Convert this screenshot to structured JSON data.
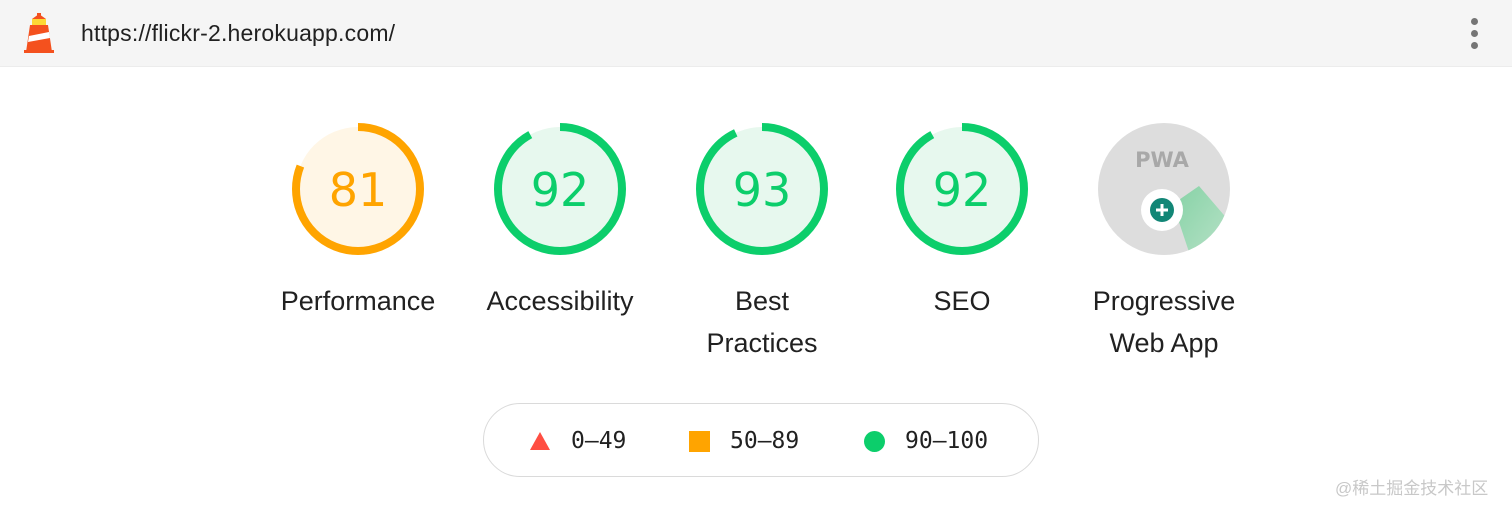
{
  "browser": {
    "url": "https://flickr-2.herokuapp.com/",
    "logo_icon": "lighthouse-icon",
    "menu_icon": "more-vert-icon"
  },
  "colors": {
    "fail": "#ff4e42",
    "average": "#ffa400",
    "pass": "#0cce6b",
    "pwa_badge": "#dddddd"
  },
  "categories": [
    {
      "name": "Performance",
      "label_lines": [
        "Performance"
      ],
      "score": "81",
      "status": "average"
    },
    {
      "name": "Accessibility",
      "label_lines": [
        "Accessibility"
      ],
      "score": "92",
      "status": "pass"
    },
    {
      "name": "Best Practices",
      "label_lines": [
        "Best",
        "Practices"
      ],
      "score": "93",
      "status": "pass"
    },
    {
      "name": "SEO",
      "label_lines": [
        "SEO"
      ],
      "score": "92",
      "status": "pass"
    },
    {
      "name": "Progressive Web App",
      "label_lines": [
        "Progressive",
        "Web App"
      ],
      "badge_text": "PWA",
      "badge_icon": "pwa-plus-icon"
    }
  ],
  "legend": [
    {
      "icon": "triangle-icon",
      "range": "0–49",
      "status": "fail"
    },
    {
      "icon": "square-icon",
      "range": "50–89",
      "status": "average"
    },
    {
      "icon": "circle-icon",
      "range": "90–100",
      "status": "pass"
    }
  ],
  "watermark": "@稀土掘金技术社区"
}
